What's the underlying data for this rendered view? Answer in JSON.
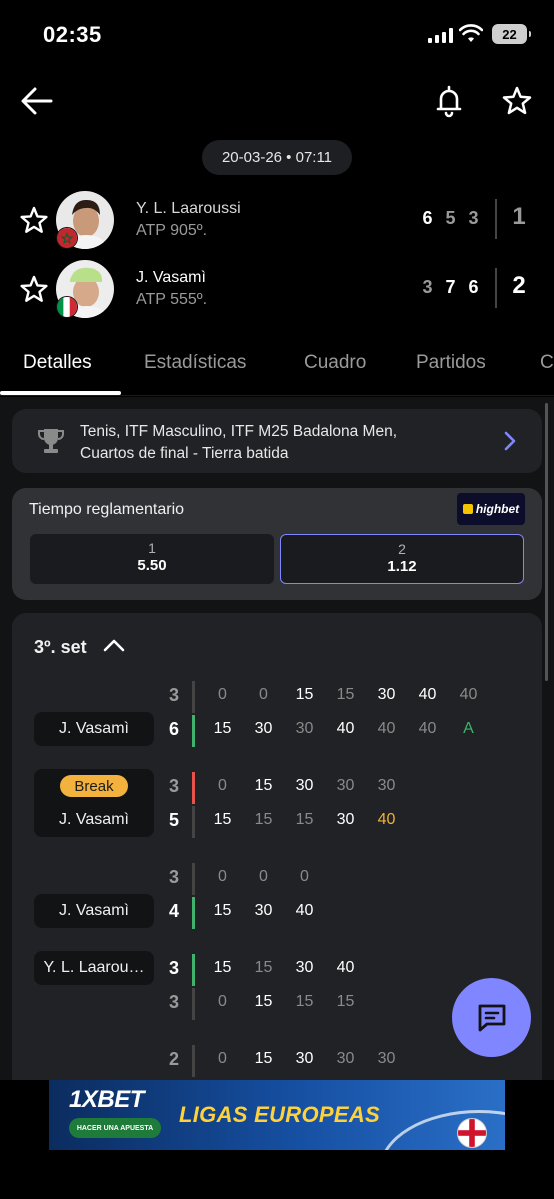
{
  "status_bar": {
    "time": "02:35",
    "battery": "22"
  },
  "match": {
    "date_time": "20-03-26 • 07:11",
    "players": [
      {
        "name": "Y. L. Laaroussi",
        "rank": "ATP 905º.",
        "sets": [
          "6",
          "5",
          "3"
        ],
        "set_winner": [
          true,
          false,
          false
        ],
        "total": "1"
      },
      {
        "name": "J. Vasamì",
        "rank": "ATP 555º.",
        "sets": [
          "3",
          "7",
          "6"
        ],
        "set_winner": [
          false,
          true,
          true
        ],
        "total": "2"
      }
    ]
  },
  "tabs": [
    "Detalles",
    "Estadísticas",
    "Cuadro",
    "Partidos",
    "C"
  ],
  "tournament": {
    "line1": "Tenis, ITF Masculino, ITF M25 Badalona Men,",
    "line2": "Cuartos de final - Tierra batida"
  },
  "odds": {
    "title": "Tiempo reglamentario",
    "brand": "highbet",
    "options": [
      {
        "label": "1",
        "value": "5.50"
      },
      {
        "label": "2",
        "value": "1.12"
      }
    ]
  },
  "set": {
    "title": "3º. set",
    "games": [
      {
        "server": "J. Vasamì",
        "break": false,
        "top": {
          "games": "3",
          "points": [
            "0",
            "0",
            "15",
            "15",
            "30",
            "40",
            "40"
          ]
        },
        "bottom": {
          "games": "6",
          "points": [
            "15",
            "30",
            "30",
            "40",
            "40",
            "40",
            "A"
          ]
        }
      },
      {
        "server": "J. Vasamì",
        "break": true,
        "break_label": "Break",
        "top": {
          "games": "3",
          "points": [
            "0",
            "15",
            "30",
            "30",
            "30"
          ]
        },
        "bottom": {
          "games": "5",
          "points": [
            "15",
            "15",
            "15",
            "30",
            "40"
          ]
        }
      },
      {
        "server": "J. Vasamì",
        "break": false,
        "top": {
          "games": "3",
          "points": [
            "0",
            "0",
            "0"
          ]
        },
        "bottom": {
          "games": "4",
          "points": [
            "15",
            "30",
            "40"
          ]
        }
      },
      {
        "server": "Y. L. Laarou…",
        "break": false,
        "top": {
          "games": "3",
          "points": [
            "15",
            "15",
            "30",
            "40"
          ]
        },
        "bottom": {
          "games": "3",
          "points": [
            "0",
            "15",
            "15",
            "15"
          ]
        }
      },
      {
        "server": "",
        "break": false,
        "top": {
          "games": "2",
          "points": [
            "0",
            "15",
            "30",
            "30",
            "30"
          ]
        }
      }
    ]
  },
  "ad": {
    "brand": "1XBET",
    "cta": "HACER UNA APUESTA",
    "slogan": "LIGAS EUROPEAS"
  },
  "colors": {
    "accent": "#7f86ff",
    "green": "#3fb36b",
    "break": "#f3b13d",
    "red": "#e5534b"
  }
}
